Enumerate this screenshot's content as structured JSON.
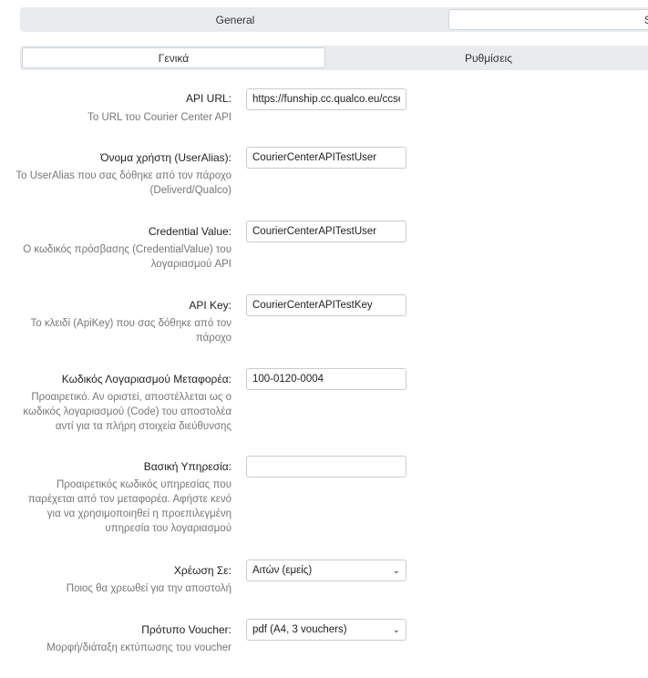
{
  "top_tabs": [
    "General",
    "S"
  ],
  "sub_tabs": [
    "Γενικά",
    "Ρυθμίσεις"
  ],
  "fields": {
    "api_url": {
      "label": "API URL:",
      "help": "Το URL του Courier Center API",
      "value": "https://funship.cc.qualco.eu/ccservice"
    },
    "user_alias": {
      "label": "Όνομα χρήστη (UserAlias):",
      "help": "Το UserAlias που σας δόθηκε από τον πάροχο (Deliverd/Qualco)",
      "value": "CourierCenterAPITestUser"
    },
    "credential_value": {
      "label": "Credential Value:",
      "help": "Ο κωδικός πρόσβασης (CredentialValue) του λογαριασμού API",
      "value": "CourierCenterAPITestUser"
    },
    "api_key": {
      "label": "API Key:",
      "help": "Το κλειδί (ApiKey) που σας δόθηκε από τον πάροχο",
      "value": "CourierCenterAPITestKey"
    },
    "carrier_account": {
      "label": "Κωδικός Λογαριασμού Μεταφορέα:",
      "help": "Προαιρετικό. Αν οριστεί, αποστέλλεται ως ο κωδικός λογαριασμού (Code) του αποστολέα αντί για τα πλήρη στοιχεία διεύθυνσης",
      "value": "100-0120-0004"
    },
    "base_service": {
      "label": "Βασική Υπηρεσία:",
      "help": "Προαιρετικός κωδικός υπηρεσίας που παρέχεται από τον μεταφορέα. Αφήστε κενό για να χρησιμοποιηθεί η προεπιλεγμένη υπηρεσία του λογαριασμού",
      "value": ""
    },
    "charge_to": {
      "label": "Χρέωση Σε:",
      "help": "Ποιος θα χρεωθεί για την αποστολή",
      "value": "Αιτών (εμείς)"
    },
    "voucher_template": {
      "label": "Πρότυπο Voucher:",
      "help": "Μορφή/διάταξη εκτύπωσης του voucher",
      "value": "pdf (A4, 3 vouchers)"
    }
  },
  "icons": {
    "dropdown": "chevron-down-icon"
  }
}
